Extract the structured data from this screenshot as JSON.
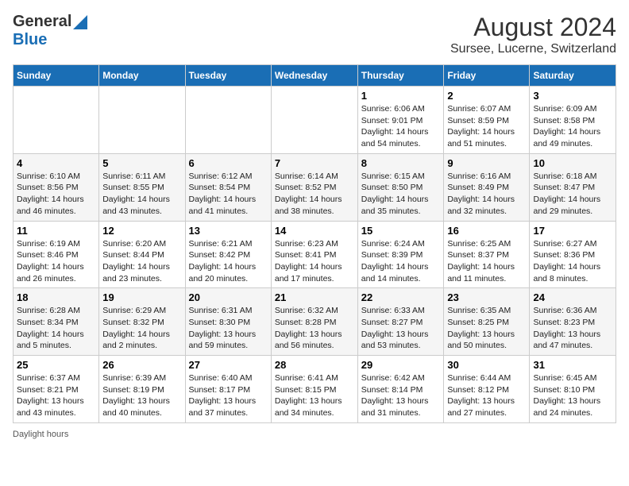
{
  "header": {
    "logo_general": "General",
    "logo_blue": "Blue",
    "title": "August 2024",
    "subtitle": "Sursee, Lucerne, Switzerland"
  },
  "days_of_week": [
    "Sunday",
    "Monday",
    "Tuesday",
    "Wednesday",
    "Thursday",
    "Friday",
    "Saturday"
  ],
  "weeks": [
    [
      {
        "day": "",
        "info": ""
      },
      {
        "day": "",
        "info": ""
      },
      {
        "day": "",
        "info": ""
      },
      {
        "day": "",
        "info": ""
      },
      {
        "day": "1",
        "info": "Sunrise: 6:06 AM\nSunset: 9:01 PM\nDaylight: 14 hours\nand 54 minutes."
      },
      {
        "day": "2",
        "info": "Sunrise: 6:07 AM\nSunset: 8:59 PM\nDaylight: 14 hours\nand 51 minutes."
      },
      {
        "day": "3",
        "info": "Sunrise: 6:09 AM\nSunset: 8:58 PM\nDaylight: 14 hours\nand 49 minutes."
      }
    ],
    [
      {
        "day": "4",
        "info": "Sunrise: 6:10 AM\nSunset: 8:56 PM\nDaylight: 14 hours\nand 46 minutes."
      },
      {
        "day": "5",
        "info": "Sunrise: 6:11 AM\nSunset: 8:55 PM\nDaylight: 14 hours\nand 43 minutes."
      },
      {
        "day": "6",
        "info": "Sunrise: 6:12 AM\nSunset: 8:54 PM\nDaylight: 14 hours\nand 41 minutes."
      },
      {
        "day": "7",
        "info": "Sunrise: 6:14 AM\nSunset: 8:52 PM\nDaylight: 14 hours\nand 38 minutes."
      },
      {
        "day": "8",
        "info": "Sunrise: 6:15 AM\nSunset: 8:50 PM\nDaylight: 14 hours\nand 35 minutes."
      },
      {
        "day": "9",
        "info": "Sunrise: 6:16 AM\nSunset: 8:49 PM\nDaylight: 14 hours\nand 32 minutes."
      },
      {
        "day": "10",
        "info": "Sunrise: 6:18 AM\nSunset: 8:47 PM\nDaylight: 14 hours\nand 29 minutes."
      }
    ],
    [
      {
        "day": "11",
        "info": "Sunrise: 6:19 AM\nSunset: 8:46 PM\nDaylight: 14 hours\nand 26 minutes."
      },
      {
        "day": "12",
        "info": "Sunrise: 6:20 AM\nSunset: 8:44 PM\nDaylight: 14 hours\nand 23 minutes."
      },
      {
        "day": "13",
        "info": "Sunrise: 6:21 AM\nSunset: 8:42 PM\nDaylight: 14 hours\nand 20 minutes."
      },
      {
        "day": "14",
        "info": "Sunrise: 6:23 AM\nSunset: 8:41 PM\nDaylight: 14 hours\nand 17 minutes."
      },
      {
        "day": "15",
        "info": "Sunrise: 6:24 AM\nSunset: 8:39 PM\nDaylight: 14 hours\nand 14 minutes."
      },
      {
        "day": "16",
        "info": "Sunrise: 6:25 AM\nSunset: 8:37 PM\nDaylight: 14 hours\nand 11 minutes."
      },
      {
        "day": "17",
        "info": "Sunrise: 6:27 AM\nSunset: 8:36 PM\nDaylight: 14 hours\nand 8 minutes."
      }
    ],
    [
      {
        "day": "18",
        "info": "Sunrise: 6:28 AM\nSunset: 8:34 PM\nDaylight: 14 hours\nand 5 minutes."
      },
      {
        "day": "19",
        "info": "Sunrise: 6:29 AM\nSunset: 8:32 PM\nDaylight: 14 hours\nand 2 minutes."
      },
      {
        "day": "20",
        "info": "Sunrise: 6:31 AM\nSunset: 8:30 PM\nDaylight: 13 hours\nand 59 minutes."
      },
      {
        "day": "21",
        "info": "Sunrise: 6:32 AM\nSunset: 8:28 PM\nDaylight: 13 hours\nand 56 minutes."
      },
      {
        "day": "22",
        "info": "Sunrise: 6:33 AM\nSunset: 8:27 PM\nDaylight: 13 hours\nand 53 minutes."
      },
      {
        "day": "23",
        "info": "Sunrise: 6:35 AM\nSunset: 8:25 PM\nDaylight: 13 hours\nand 50 minutes."
      },
      {
        "day": "24",
        "info": "Sunrise: 6:36 AM\nSunset: 8:23 PM\nDaylight: 13 hours\nand 47 minutes."
      }
    ],
    [
      {
        "day": "25",
        "info": "Sunrise: 6:37 AM\nSunset: 8:21 PM\nDaylight: 13 hours\nand 43 minutes."
      },
      {
        "day": "26",
        "info": "Sunrise: 6:39 AM\nSunset: 8:19 PM\nDaylight: 13 hours\nand 40 minutes."
      },
      {
        "day": "27",
        "info": "Sunrise: 6:40 AM\nSunset: 8:17 PM\nDaylight: 13 hours\nand 37 minutes."
      },
      {
        "day": "28",
        "info": "Sunrise: 6:41 AM\nSunset: 8:15 PM\nDaylight: 13 hours\nand 34 minutes."
      },
      {
        "day": "29",
        "info": "Sunrise: 6:42 AM\nSunset: 8:14 PM\nDaylight: 13 hours\nand 31 minutes."
      },
      {
        "day": "30",
        "info": "Sunrise: 6:44 AM\nSunset: 8:12 PM\nDaylight: 13 hours\nand 27 minutes."
      },
      {
        "day": "31",
        "info": "Sunrise: 6:45 AM\nSunset: 8:10 PM\nDaylight: 13 hours\nand 24 minutes."
      }
    ]
  ],
  "footer_text": "Daylight hours"
}
